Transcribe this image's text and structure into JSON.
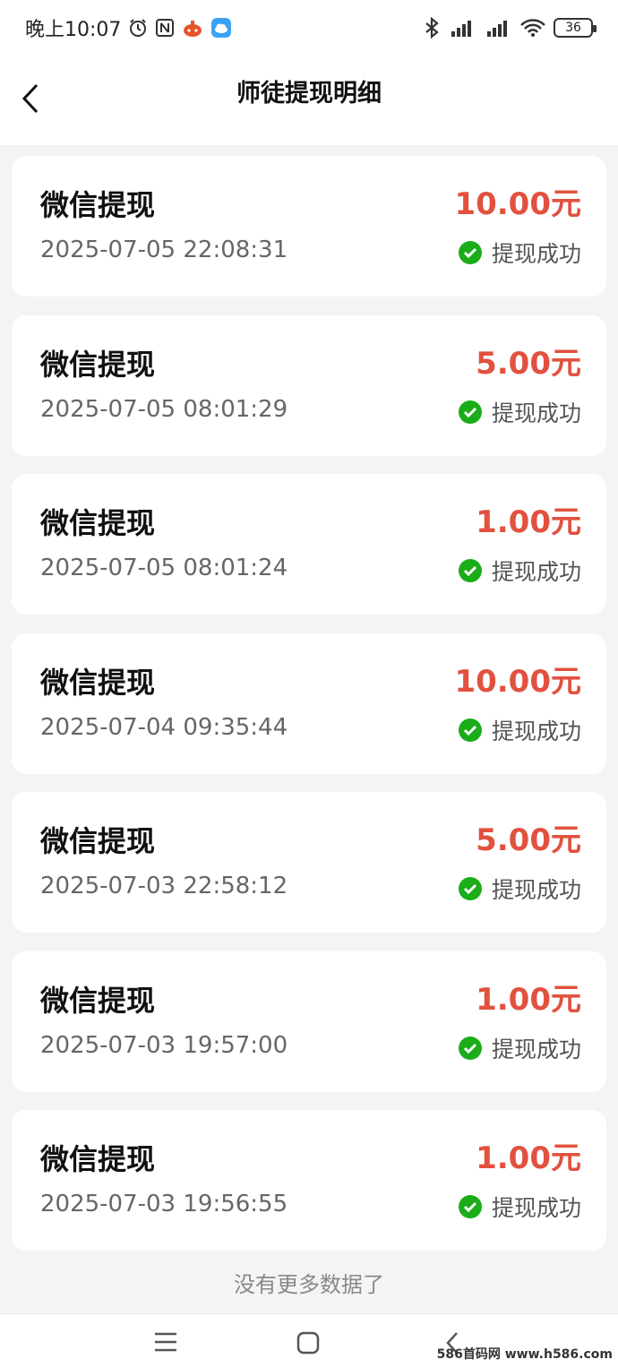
{
  "status_bar": {
    "time": "晚上10:07",
    "battery": "36"
  },
  "nav": {
    "title": "师徒提现明细"
  },
  "records": [
    {
      "title": "微信提现",
      "amount": "10.00元",
      "time": "2025-07-05 22:08:31",
      "status": "提现成功"
    },
    {
      "title": "微信提现",
      "amount": "5.00元",
      "time": "2025-07-05 08:01:29",
      "status": "提现成功"
    },
    {
      "title": "微信提现",
      "amount": "1.00元",
      "time": "2025-07-05 08:01:24",
      "status": "提现成功"
    },
    {
      "title": "微信提现",
      "amount": "10.00元",
      "time": "2025-07-04 09:35:44",
      "status": "提现成功"
    },
    {
      "title": "微信提现",
      "amount": "5.00元",
      "time": "2025-07-03 22:58:12",
      "status": "提现成功"
    },
    {
      "title": "微信提现",
      "amount": "1.00元",
      "time": "2025-07-03 19:57:00",
      "status": "提现成功"
    },
    {
      "title": "微信提现",
      "amount": "1.00元",
      "time": "2025-07-03 19:56:55",
      "status": "提现成功"
    }
  ],
  "footer": {
    "no_more": "没有更多数据了"
  },
  "watermark": "586首码网 www.h586.com",
  "colors": {
    "amount": "#e2513f",
    "wechat_green": "#1aad19",
    "background": "#f4f4f4"
  }
}
